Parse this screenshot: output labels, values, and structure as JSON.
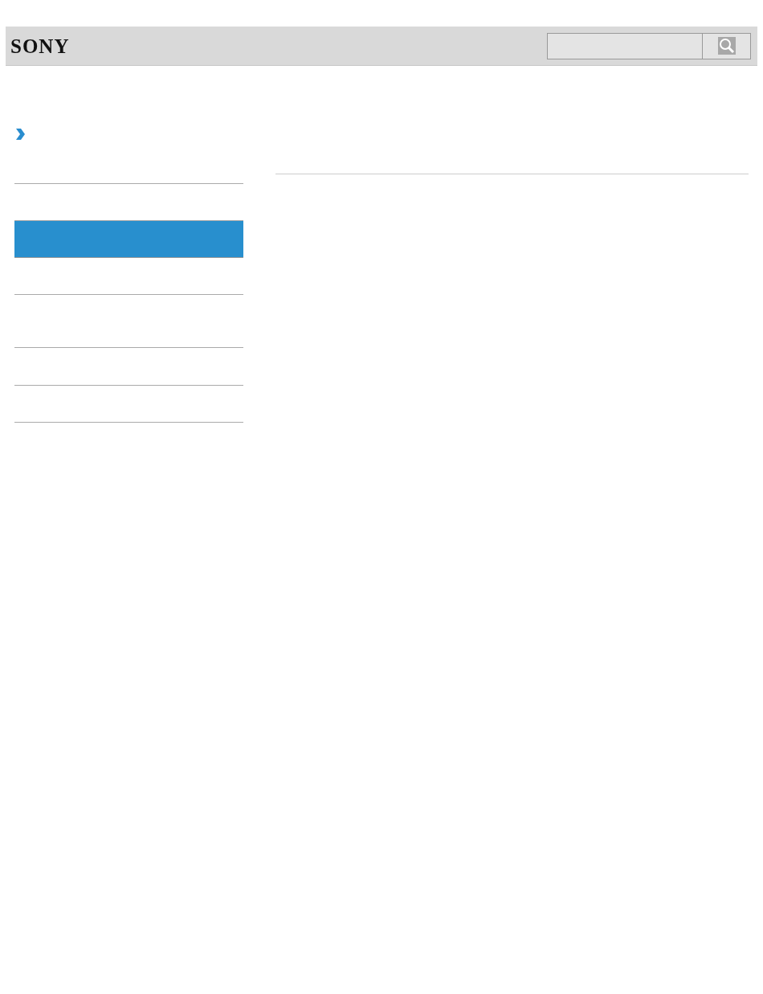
{
  "header": {
    "logo": "SONY"
  },
  "sidebar": {
    "items": [
      {
        "selected": false
      },
      {
        "selected": true
      },
      {
        "selected": false
      },
      {
        "selected": false
      },
      {
        "selected": false
      },
      {
        "selected": false
      }
    ]
  }
}
